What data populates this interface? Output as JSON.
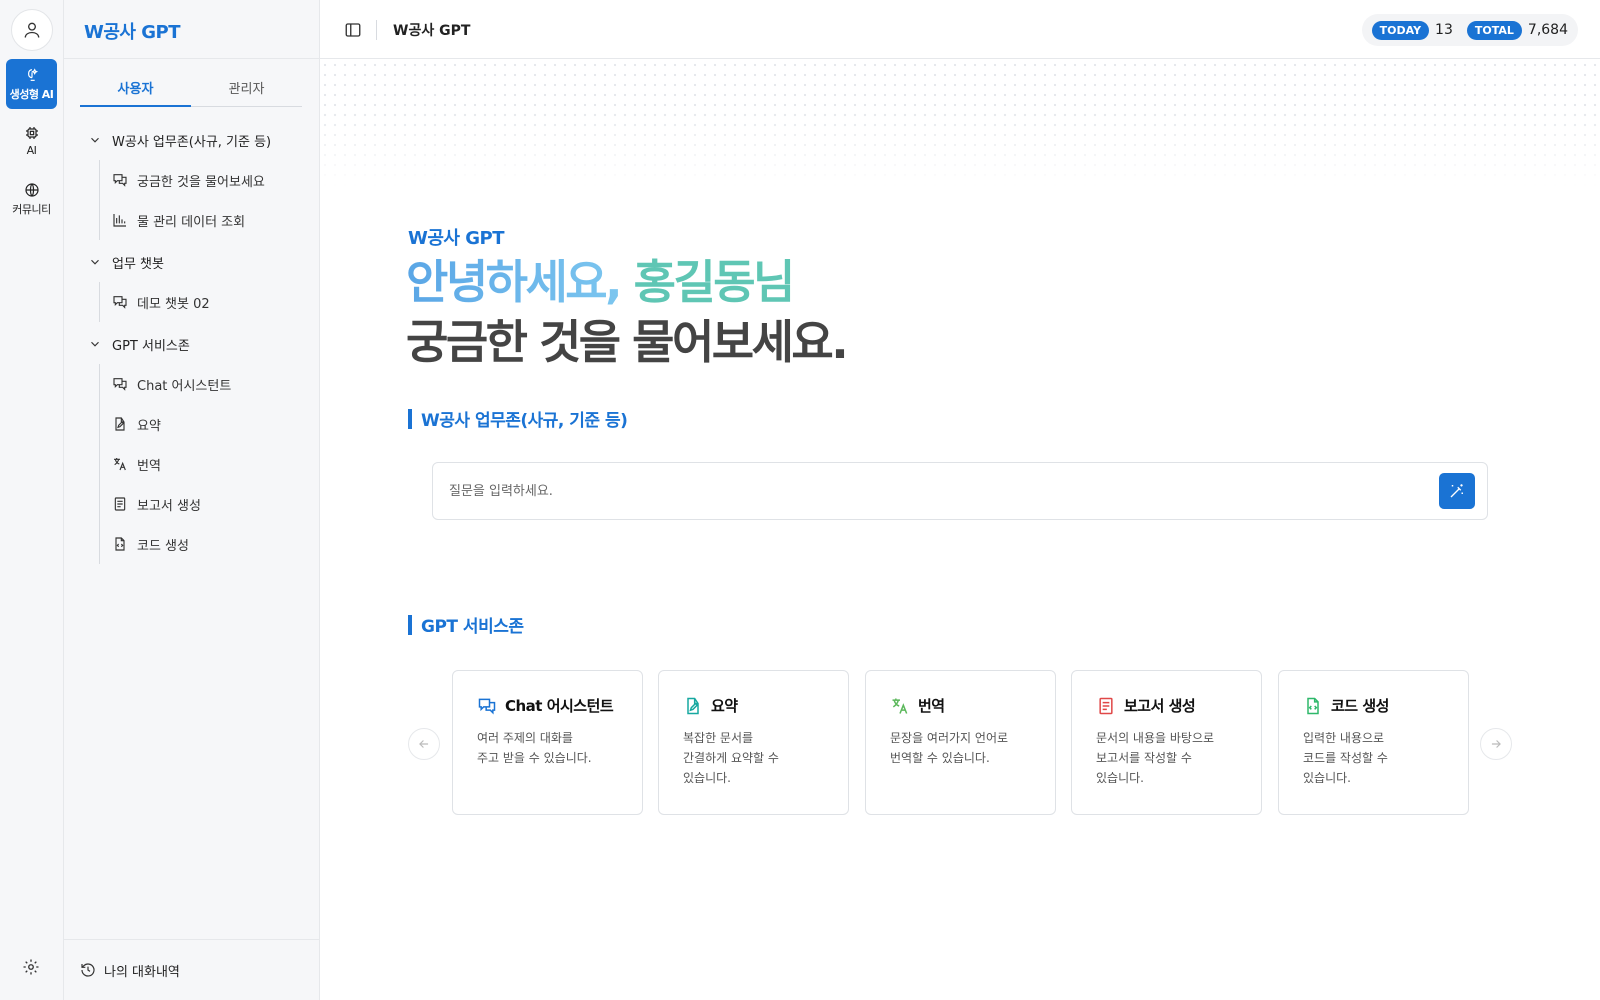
{
  "app": {
    "title": "W공사 GPT"
  },
  "rail": {
    "items": [
      {
        "label": "생성형 AI",
        "icon": "sparkle-brain-icon",
        "active": true
      },
      {
        "label": "AI",
        "icon": "chip-icon",
        "active": false
      },
      {
        "label": "커뮤니티",
        "icon": "globe-icon",
        "active": false
      }
    ],
    "avatar_icon": "user-icon",
    "settings_icon": "gear-icon"
  },
  "sidenav": {
    "brand": "W공사 GPT",
    "tabs": [
      {
        "label": "사용자",
        "active": true
      },
      {
        "label": "관리자",
        "active": false
      }
    ],
    "groups": [
      {
        "label": "W공사 업무존(사규, 기준 등)",
        "children": [
          {
            "label": "궁금한 것을 물어보세요",
            "icon": "chat-icon"
          },
          {
            "label": "물 관리 데이터 조회",
            "icon": "data-chart-icon"
          }
        ]
      },
      {
        "label": "업무 챗봇",
        "children": [
          {
            "label": "데모 챗봇 02",
            "icon": "chat-icon"
          }
        ]
      },
      {
        "label": "GPT 서비스존",
        "children": [
          {
            "label": "Chat 어시스턴트",
            "icon": "chat-icon"
          },
          {
            "label": "요약",
            "icon": "edit-doc-icon"
          },
          {
            "label": "번역",
            "icon": "translate-icon"
          },
          {
            "label": "보고서 생성",
            "icon": "report-icon"
          },
          {
            "label": "코드 생성",
            "icon": "code-file-icon"
          }
        ]
      }
    ],
    "history_label": "나의 대화내역"
  },
  "header": {
    "title": "W공사 GPT",
    "today_label": "TODAY",
    "today_value": "13",
    "total_label": "TOTAL",
    "total_value": "7,684"
  },
  "hero": {
    "eyebrow": "W공사 GPT",
    "greeting_part1": "안녕하세요,",
    "greeting_part2": "홍길동님",
    "tagline": "궁금한 것을 물어보세요."
  },
  "work_zone": {
    "title": "W공사 업무존(사규, 기준 등)",
    "input_placeholder": "질문을 입력하세요.",
    "input_value": ""
  },
  "service_zone": {
    "title": "GPT 서비스존",
    "cards": [
      {
        "title": "Chat 어시스턴트",
        "desc": "여러 주제의 대화를\n주고 받을 수 있습니다.",
        "icon": "chat-icon",
        "color": "#1a73d4"
      },
      {
        "title": "요약",
        "desc": "복잡한 문서를\n간결하게 요약할 수\n있습니다.",
        "icon": "edit-doc-icon",
        "color": "#17a8a0"
      },
      {
        "title": "번역",
        "desc": "문장을 여러가지 언어로\n번역할 수 있습니다.",
        "icon": "translate-icon",
        "color": "#5cb85c"
      },
      {
        "title": "보고서 생성",
        "desc": "문서의 내용을 바탕으로\n보고서를 작성할 수\n있습니다.",
        "icon": "report-icon",
        "color": "#e04848"
      },
      {
        "title": "코드 생성",
        "desc": "입력한 내용으로\n코드를 작성할 수\n있습니다.",
        "icon": "code-file-icon",
        "color": "#2eb86a"
      }
    ]
  },
  "colors": {
    "accent": "#1a73d4",
    "teal": "#5fc6b4",
    "sidebar_bg": "#f6f7f9"
  }
}
